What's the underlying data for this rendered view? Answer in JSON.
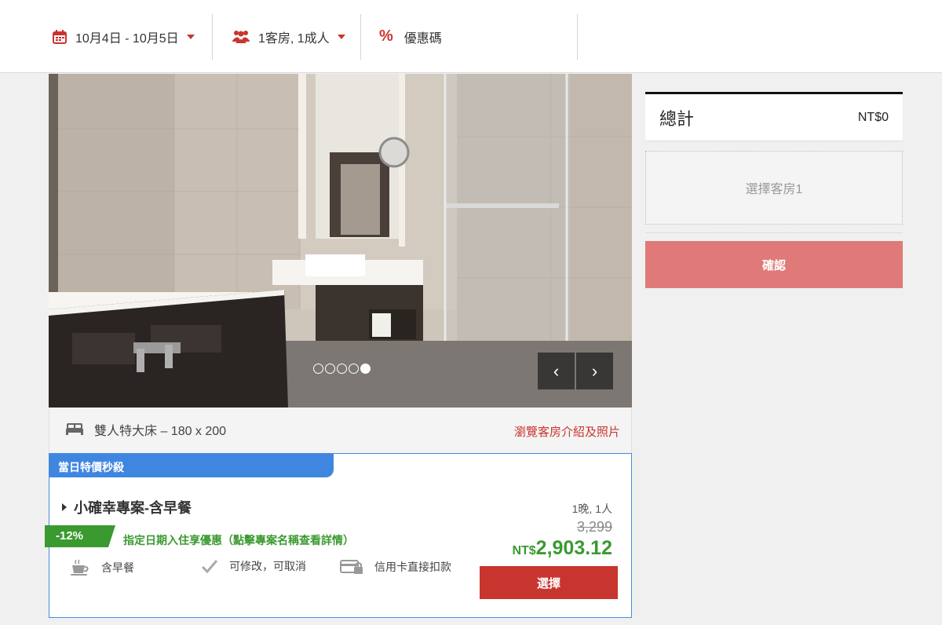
{
  "search_bar": {
    "dates": "10月4日 - 10月5日",
    "guests": "1客房, 1成人",
    "promo_label": "優惠碼",
    "promo_symbol": "%"
  },
  "gallery": {
    "total_slides": 5,
    "active_slide": 5,
    "prev_symbol": "‹",
    "next_symbol": "›"
  },
  "room": {
    "bed_text": "雙人特大床 – 180 x 200",
    "details_link": "瀏覽客房介紹及照片"
  },
  "rate": {
    "tag": "當日特價秒殺",
    "plan_name": "小確幸專案-含早餐",
    "discount": "-12%",
    "promo_text": "指定日期入住享優惠（點擊專案名稱查看詳情）",
    "stay_info": "1晚, 1人",
    "original_price": "3,299",
    "currency": "NT$",
    "price": "2,903.12",
    "select_label": "選擇",
    "amenities": [
      {
        "icon": "coffee-cup-icon",
        "label": "含早餐"
      },
      {
        "icon": "checkmark-icon",
        "label": "可修改，可取消"
      },
      {
        "icon": "credit-card-lock-icon",
        "label": "信用卡直接扣款"
      }
    ]
  },
  "summary": {
    "total_label": "總計",
    "total_amount": "NT$0",
    "room_placeholder": "選擇客房1",
    "confirm_label": "確認"
  },
  "colors": {
    "accent_red": "#c8352f",
    "confirm_disabled": "#df7a78",
    "promo_green": "#3a9a2f",
    "tag_blue": "#3f86e0"
  }
}
